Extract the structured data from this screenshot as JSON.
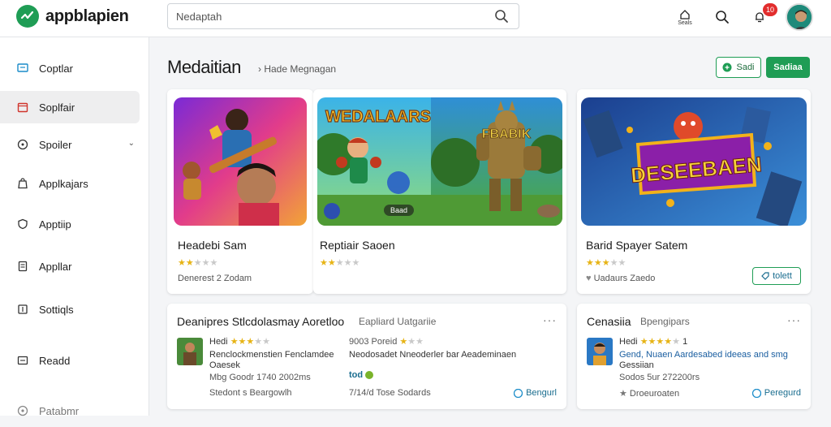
{
  "app": {
    "name": "appblapien"
  },
  "search": {
    "value": "Nedaptah"
  },
  "top_icons": {
    "home_label": "Seals",
    "notifications_count": "10"
  },
  "sidebar": {
    "items": [
      {
        "label": "Coptlar"
      },
      {
        "label": "Soplfair"
      },
      {
        "label": "Spoiler"
      },
      {
        "label": "Applkajars"
      },
      {
        "label": "Apptiip"
      },
      {
        "label": "Appllar"
      },
      {
        "label": "Sottiqls"
      },
      {
        "label": "Readd"
      },
      {
        "label": "Patabmr"
      }
    ]
  },
  "main": {
    "title": "Medaitian",
    "breadcrumb": "› Hade Megnagan",
    "btn_outline": "Sadi",
    "btn_solid": "Sadiaa"
  },
  "featured": [
    {
      "title": "Headebi Sam",
      "rating": 2,
      "meta": "Denerest 2 Zodam",
      "img_chip": ""
    },
    {
      "title": "Reptiair Saoen",
      "rating": 2,
      "meta": "",
      "img_title": "WEDALAARS",
      "img_sub": "FBABIK",
      "img_chip": "Baad"
    },
    {
      "title": "Barid Spayer Satem",
      "rating": 3,
      "meta": "Uadaurs Zaedo",
      "img_title": "DESEEBAEN",
      "btn": "tolett"
    }
  ],
  "lists": [
    {
      "title": "Deanipres Stlcdolasmay Aoretloo",
      "subtitle": "Eapliard Uatgariie",
      "col1": {
        "label": "Hedi",
        "line1": "Renclockmenstien Fenclamdee",
        "line2": "Oaesek",
        "line3": "Mbg Goodr 1740 2002ms",
        "footer": "Stedont s Beargowlh"
      },
      "col2": {
        "line0": "9003 Poreid",
        "line1": "Neodosadet Nneoderler bar Aeademinaen",
        "tag": "tod",
        "footer": "7/14/d Tose Sodards"
      },
      "action": "Bengurl"
    },
    {
      "title": "Cenasiia",
      "subtitle": "Bpengipars",
      "label": "Hedi",
      "count": "1",
      "line1": "Gend, Nuaen Aardesabed ideeas and smg",
      "line2": "Gessiian",
      "line3": "Sodos 5ur 272200rs",
      "footer": "Droeuroaten",
      "action": "Peregurd"
    }
  ],
  "colors": {
    "accent": "#1f9d55",
    "link": "#1a6d8f",
    "star": "#e7b416"
  }
}
